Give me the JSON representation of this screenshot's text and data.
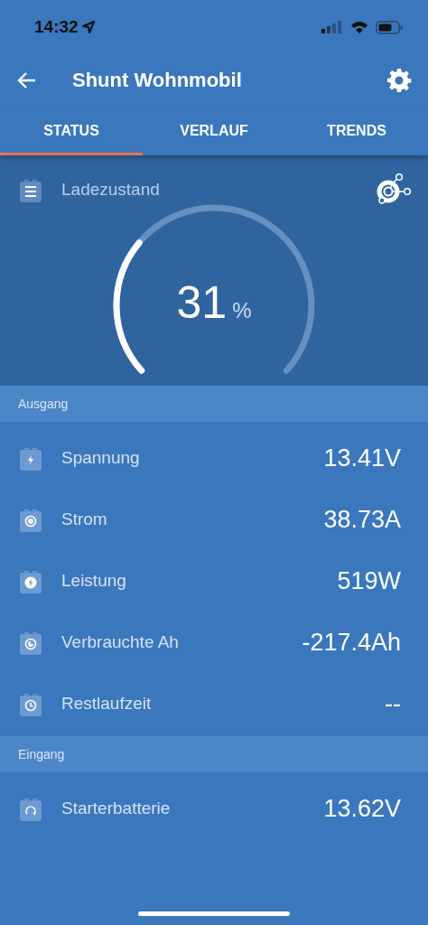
{
  "status_bar": {
    "time": "14:32"
  },
  "header": {
    "title": "Shunt Wohnmobil"
  },
  "tabs": [
    {
      "label": "STATUS",
      "selected": true
    },
    {
      "label": "VERLAUF",
      "selected": false
    },
    {
      "label": "TRENDS",
      "selected": false
    }
  ],
  "gauge": {
    "title": "Ladezustand",
    "value": "31",
    "unit": "%"
  },
  "sections": [
    {
      "title": "Ausgang",
      "rows": [
        {
          "kind": "voltage",
          "label": "Spannung",
          "value": "13.41V"
        },
        {
          "kind": "current",
          "label": "Strom",
          "value": "38.73A"
        },
        {
          "kind": "power",
          "label": "Leistung",
          "value": "519W"
        },
        {
          "kind": "consumed",
          "label": "Verbrauchte Ah",
          "value": "-217.4Ah"
        },
        {
          "kind": "time",
          "label": "Restlaufzeit",
          "value": "--"
        }
      ]
    },
    {
      "title": "Eingang",
      "rows": [
        {
          "kind": "starter",
          "label": "Starterbatterie",
          "value": "13.62V"
        }
      ]
    }
  ]
}
